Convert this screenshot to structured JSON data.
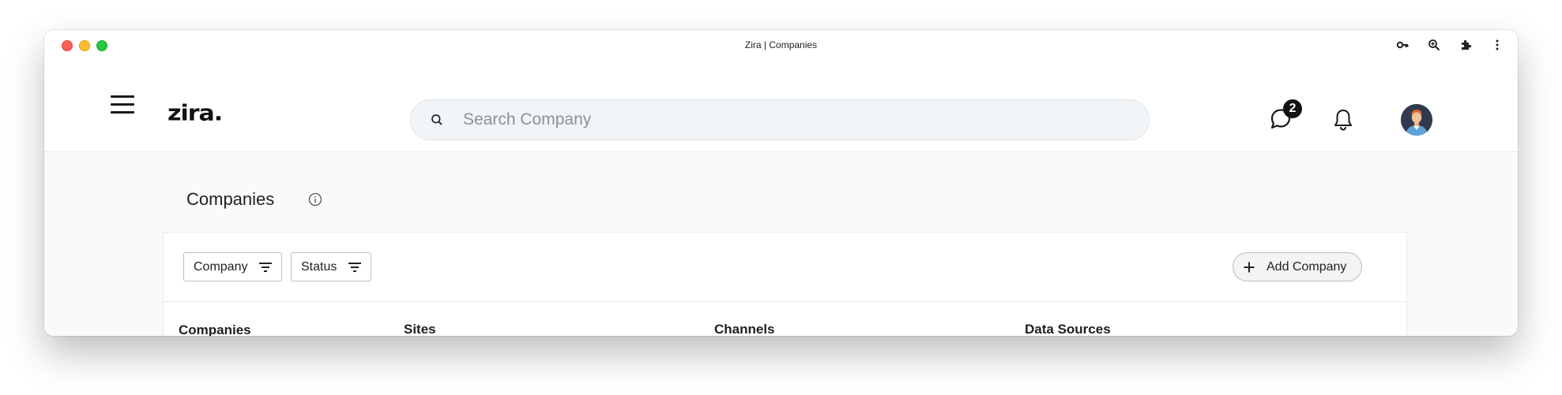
{
  "window": {
    "title": "Zira | Companies"
  },
  "header": {
    "logo": "zira.",
    "search_placeholder": "Search Company",
    "chat_badge": "2"
  },
  "page": {
    "title": "Companies",
    "filters": [
      {
        "label": "Company"
      },
      {
        "label": "Status"
      }
    ],
    "add_button": "Add Company",
    "table": {
      "columns": [
        "Companies",
        "Sites",
        "Channels",
        "Data Sources"
      ]
    }
  },
  "icons": {
    "browser_toolbar": [
      "key-icon",
      "zoom-icon",
      "extensions-icon",
      "more-vertical-icon"
    ],
    "header": [
      "menu-icon",
      "search-icon",
      "chat-icon",
      "bell-icon"
    ]
  }
}
